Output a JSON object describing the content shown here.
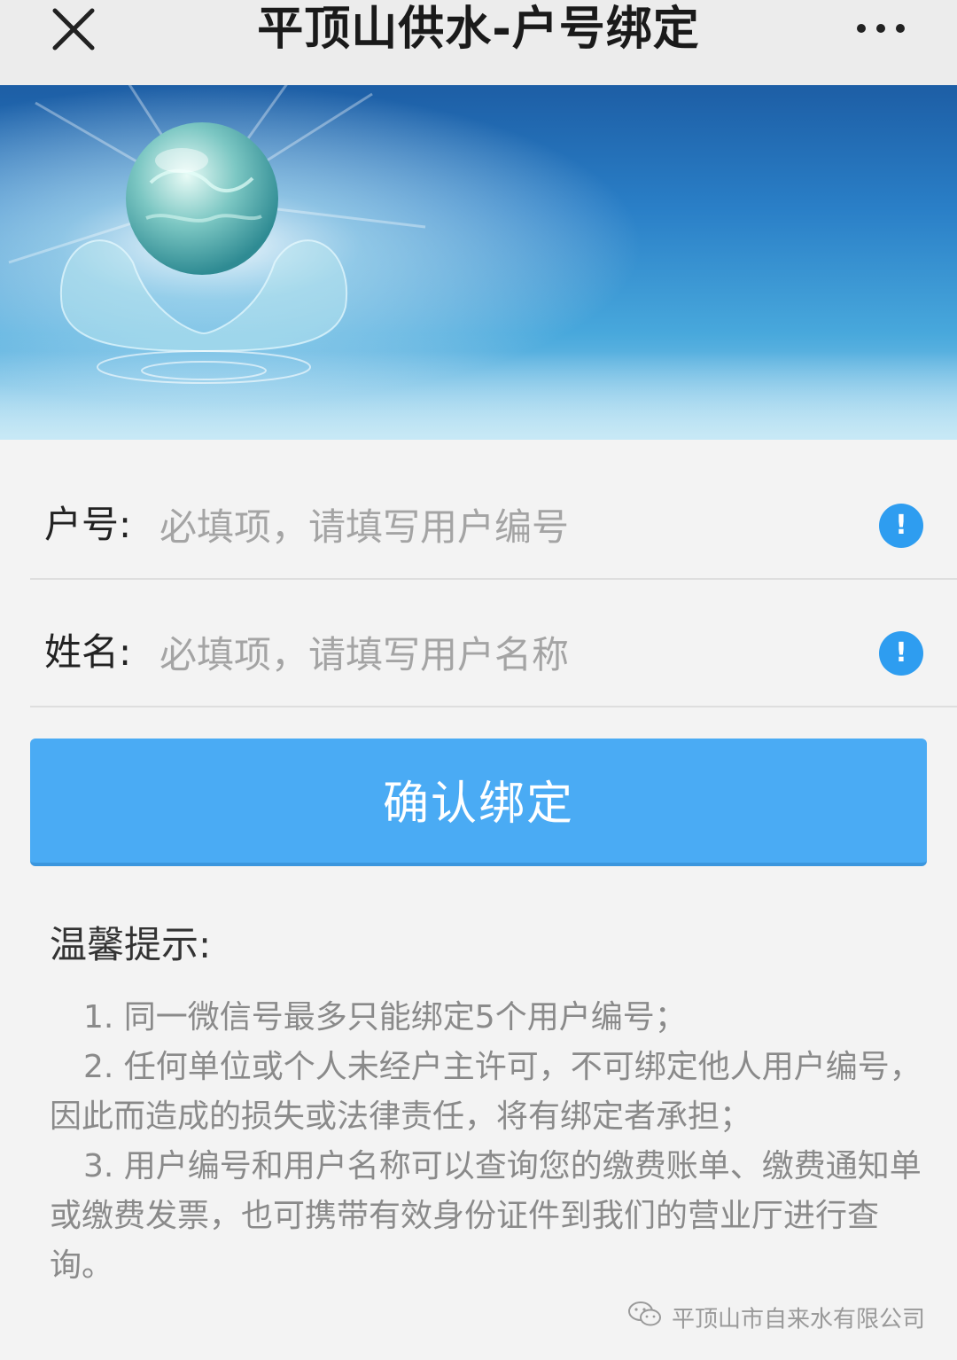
{
  "header": {
    "title": "平顶山供水-户号绑定",
    "close_icon": "close-icon",
    "more_icon": "more-horizontal-icon"
  },
  "form": {
    "account": {
      "label": "户号:",
      "placeholder": "必填项，请填写用户编号",
      "value": ""
    },
    "name": {
      "label": "姓名:",
      "placeholder": "必填项，请填写用户名称",
      "value": ""
    },
    "alert_icon": "!"
  },
  "confirm_button": {
    "label": "确认绑定"
  },
  "tips": {
    "title": "温馨提示:",
    "items": [
      "1. 同一微信号最多只能绑定5个用户编号；",
      "2. 任何单位或个人未经户主许可，不可绑定他人用户编号，因此而造成的损失或法律责任，将有绑定者承担；",
      "3. 用户编号和用户名称可以查询您的缴费账单、缴费通知单或缴费发票，也可携带有效身份证件到我们的营业厅进行查询。"
    ]
  },
  "watermark": {
    "text": "平顶山市自来水有限公司"
  },
  "colors": {
    "accent": "#4aabf4",
    "alert": "#2e9df0",
    "background": "#f3f3f3"
  }
}
